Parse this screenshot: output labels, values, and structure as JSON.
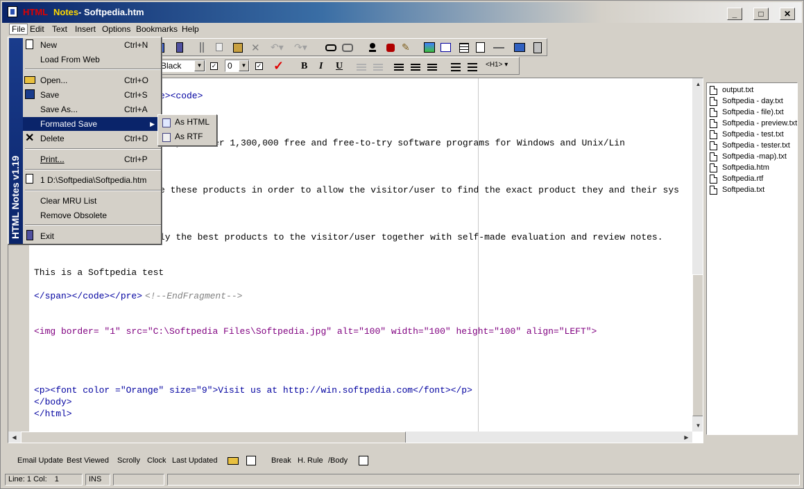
{
  "titlebar": {
    "part1": "HTML",
    "part2": "Notes",
    "part3": "- Softpedia.htm"
  },
  "window_controls": {
    "minimize": "_",
    "maximize": "□",
    "close": "✕"
  },
  "menubar": [
    "File",
    "Edit",
    "Text",
    "Insert",
    "Options",
    "Bookmarks",
    "Help"
  ],
  "format_toolbar": {
    "color": "Black",
    "size": "0",
    "bold": "B",
    "italic": "I",
    "underline": "U",
    "heading": "<H1>"
  },
  "editor": {
    "lines": [
      "e><code>",
      "rary of over 1,300,000 free and free-to-try software programs for Windows and Unix/Lin",
      "e these products in order to allow the visitor/user to find the exact product they and their sys",
      "ly the best products to the visitor/user together with self-made evaluation and review notes.",
      "This is a Softpedia test",
      "</span></code></pre>",
      "<!--EndFragment-->",
      "<img border= \"1\" src=\"C:\\Softpedia Files\\Softpedia.jpg\" alt=\"100\" width=\"100\" height=\"100\" align=\"LEFT\">",
      "<p><font color =\"Orange\" size=\"9\">Visit us at http://win.softpedia.com</font></p>",
      "</body>",
      "</html>"
    ]
  },
  "files": [
    "output.txt",
    "Softpedia - day.txt",
    "Softpedia - file).txt",
    "Softpedia - preview.txt",
    "Softpedia - test.txt",
    "Softpedia - tester.txt",
    "Softpedia -map).txt",
    "Softpedia.htm",
    "Softpedia.rtf",
    "Softpedia.txt"
  ],
  "bottombar": {
    "items1": [
      "Email Update",
      "Best Viewed",
      "Scrolly",
      "Clock",
      "Last Updated"
    ],
    "items2": [
      "Break",
      "H. Rule",
      "/Body"
    ]
  },
  "status": {
    "line_label": "Line:",
    "line_value": "1",
    "col_label": "Col:",
    "col_value": "1",
    "mode": "INS"
  },
  "file_menu": {
    "side_title": "HTML Notes v1.19",
    "items": [
      {
        "label": "New",
        "shortcut": "Ctrl+N",
        "icon": "new-icon"
      },
      {
        "label": "Load From Web",
        "shortcut": ""
      },
      {
        "label": "Open...",
        "shortcut": "Ctrl+O",
        "icon": "open-icon"
      },
      {
        "label": "Save",
        "shortcut": "Ctrl+S",
        "icon": "save-icon"
      },
      {
        "label": "Save As...",
        "shortcut": "Ctrl+A"
      },
      {
        "label": "Formated Save",
        "shortcut": ""
      },
      {
        "label": "Delete",
        "shortcut": "Ctrl+D",
        "icon": "delete-icon"
      },
      {
        "label": "Print...",
        "shortcut": "Ctrl+P"
      },
      {
        "label": "1 D:\\Softpedia\\Softpedia.htm",
        "shortcut": "",
        "icon": "doc-icon"
      },
      {
        "label": "Clear MRU List",
        "shortcut": ""
      },
      {
        "label": "Remove Obsolete",
        "shortcut": ""
      },
      {
        "label": "Exit",
        "shortcut": "",
        "icon": "exit-icon"
      }
    ]
  },
  "submenu": {
    "items": [
      "As HTML",
      "As RTF"
    ]
  }
}
